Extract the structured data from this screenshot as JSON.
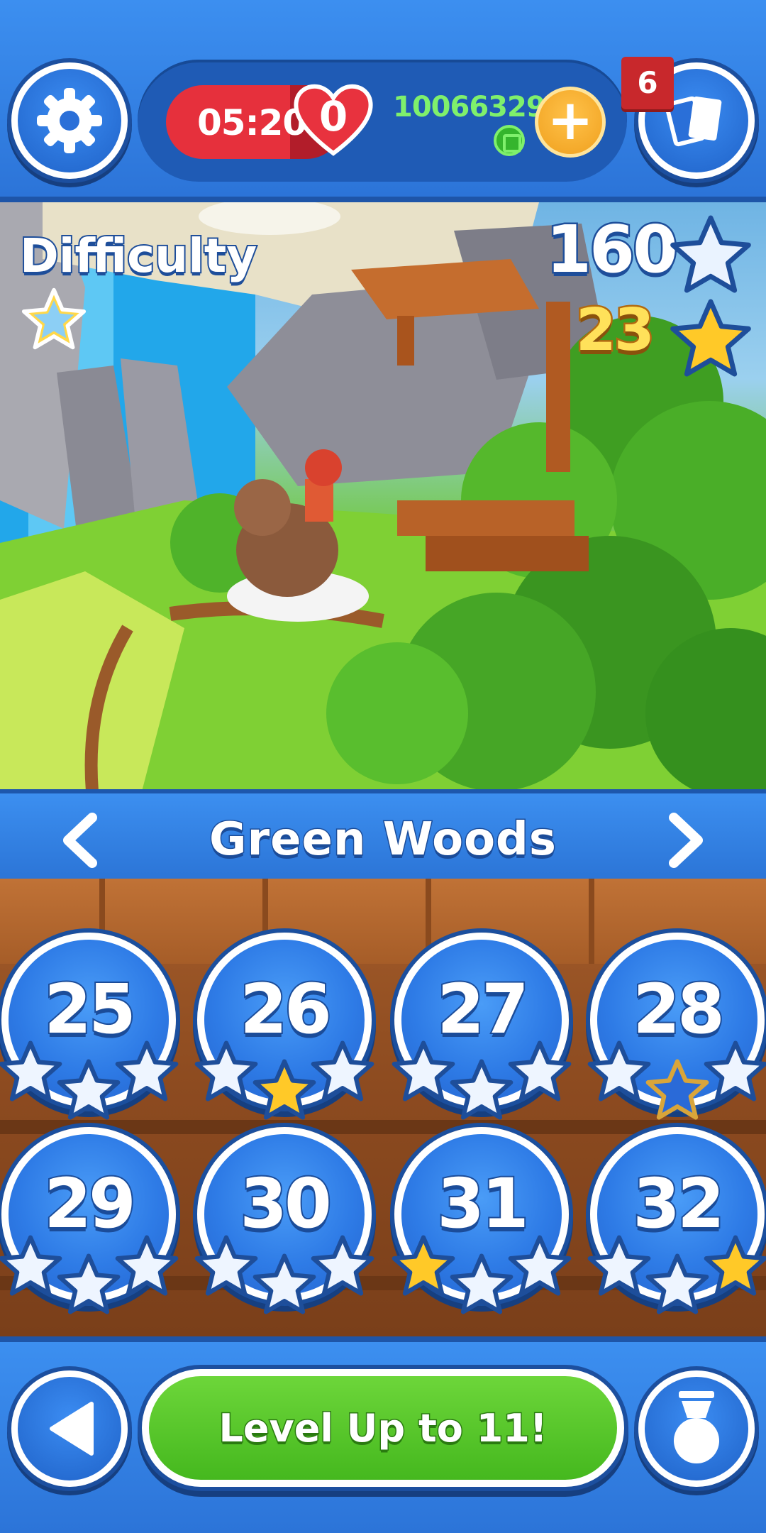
{
  "header": {
    "timer": "05:20",
    "lives": "0",
    "coins": "100663296",
    "cards_badge": "6"
  },
  "scene": {
    "difficulty_label": "Difficulty",
    "stars_total": "160",
    "stars_gold": "23"
  },
  "world": {
    "title": "Green Woods"
  },
  "levels": [
    {
      "number": "25",
      "stars": [
        "white",
        "white",
        "white"
      ]
    },
    {
      "number": "26",
      "stars": [
        "white",
        "gold",
        "white"
      ]
    },
    {
      "number": "27",
      "stars": [
        "white",
        "white",
        "white"
      ]
    },
    {
      "number": "28",
      "stars": [
        "white",
        "outline",
        "white"
      ]
    },
    {
      "number": "29",
      "stars": [
        "white",
        "white",
        "white"
      ]
    },
    {
      "number": "30",
      "stars": [
        "white",
        "white",
        "white"
      ]
    },
    {
      "number": "31",
      "stars": [
        "gold",
        "white",
        "white"
      ]
    },
    {
      "number": "32",
      "stars": [
        "white",
        "white",
        "gold"
      ]
    }
  ],
  "footer": {
    "level_up_label": "Level Up to 11!"
  },
  "icons": {
    "settings": "gear-icon",
    "heart": "heart-icon",
    "coin": "coin-icon",
    "add": "plus-icon",
    "cards": "cards-icon",
    "difficulty": "star-icon",
    "prev": "chevron-left-icon",
    "next": "chevron-right-icon",
    "back": "back-triangle-icon",
    "medal": "medal-icon"
  },
  "colors": {
    "primary_blue": "#2e7be6",
    "timer_red": "#e6303c",
    "coin_green": "#7ff06c",
    "gold": "#ffc928",
    "button_green": "#45b81e"
  }
}
